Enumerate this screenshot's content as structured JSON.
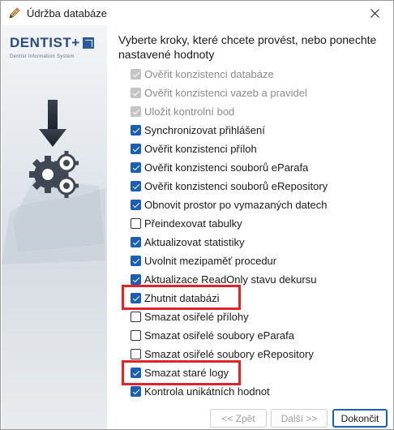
{
  "window": {
    "title": "Údržba databáze",
    "title_icon": "pen-icon",
    "close_icon": "close-icon"
  },
  "banner": {
    "logo": "DENTIST+",
    "logo_sub": "Dentist Information System",
    "art_icon": "download-gears-icon"
  },
  "instruction": "Vyberte kroky, které chcete provést, nebo ponechte nastavené hodnoty",
  "steps": [
    {
      "label": "Ověřit konzistenci databáze",
      "checked": true,
      "disabled": true
    },
    {
      "label": "Ověřit konzistenci vazeb a pravidel",
      "checked": true,
      "disabled": true
    },
    {
      "label": "Uložit kontrolní bod",
      "checked": true,
      "disabled": true
    },
    {
      "label": "Synchronizovat přihlášení",
      "checked": true,
      "disabled": false
    },
    {
      "label": "Ověřit konzistenci příloh",
      "checked": true,
      "disabled": false
    },
    {
      "label": "Ověřit konzistenci souborů eParafa",
      "checked": true,
      "disabled": false
    },
    {
      "label": "Ověřit konzistenci souborů eRepository",
      "checked": true,
      "disabled": false
    },
    {
      "label": "Obnovit prostor po vymazaných datech",
      "checked": true,
      "disabled": false
    },
    {
      "label": "Přeindexovat tabulky",
      "checked": false,
      "disabled": false
    },
    {
      "label": "Aktualizovat statistiky",
      "checked": true,
      "disabled": false
    },
    {
      "label": "Uvolnit mezipaměť procedur",
      "checked": true,
      "disabled": false
    },
    {
      "label": "Aktualizace ReadOnly stavu dekursu",
      "checked": true,
      "disabled": false
    },
    {
      "label": "Zhutnit databázi",
      "checked": true,
      "disabled": false,
      "highlighted": true
    },
    {
      "label": "Smazat osiřelé přílohy",
      "checked": false,
      "disabled": false
    },
    {
      "label": "Smazat osiřelé soubory eParafa",
      "checked": false,
      "disabled": false
    },
    {
      "label": "Smazat osiřelé soubory eRepository",
      "checked": false,
      "disabled": false
    },
    {
      "label": "Smazat staré logy",
      "checked": true,
      "disabled": false,
      "highlighted": true
    },
    {
      "label": "Kontrola unikátních hodnot",
      "checked": true,
      "disabled": false
    }
  ],
  "buttons": {
    "back": "<< Zpět",
    "next": "Další >>",
    "finish": "Dokončit"
  },
  "colors": {
    "accent": "#1a5fb4",
    "highlight": "#e0242b",
    "logo": "#2b4c7e"
  }
}
